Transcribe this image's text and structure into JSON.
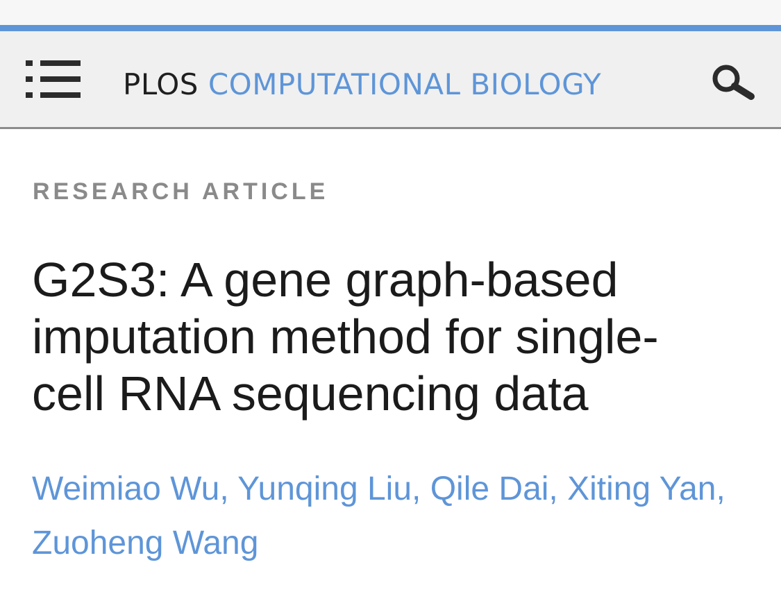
{
  "header": {
    "brand_prefix": "PLOS",
    "brand_journal": "COMPUTATIONAL BIOLOGY",
    "menu_icon": "menu-icon",
    "search_icon": "search-icon"
  },
  "article": {
    "type": "RESEARCH ARTICLE",
    "title_line1": "G2S3: A gene graph-based",
    "title_line2": "imputation method for single-",
    "title_line3": "cell RNA sequencing data",
    "authors": [
      "Weimiao Wu",
      "Yunqing Liu",
      "Qile Dai",
      "Xiting Yan",
      "Zuoheng Wang"
    ]
  },
  "colors": {
    "accent": "#5e95d8",
    "header_bg": "#f0f0f0",
    "text": "#1b1b1b",
    "muted": "#8a8a8a"
  }
}
